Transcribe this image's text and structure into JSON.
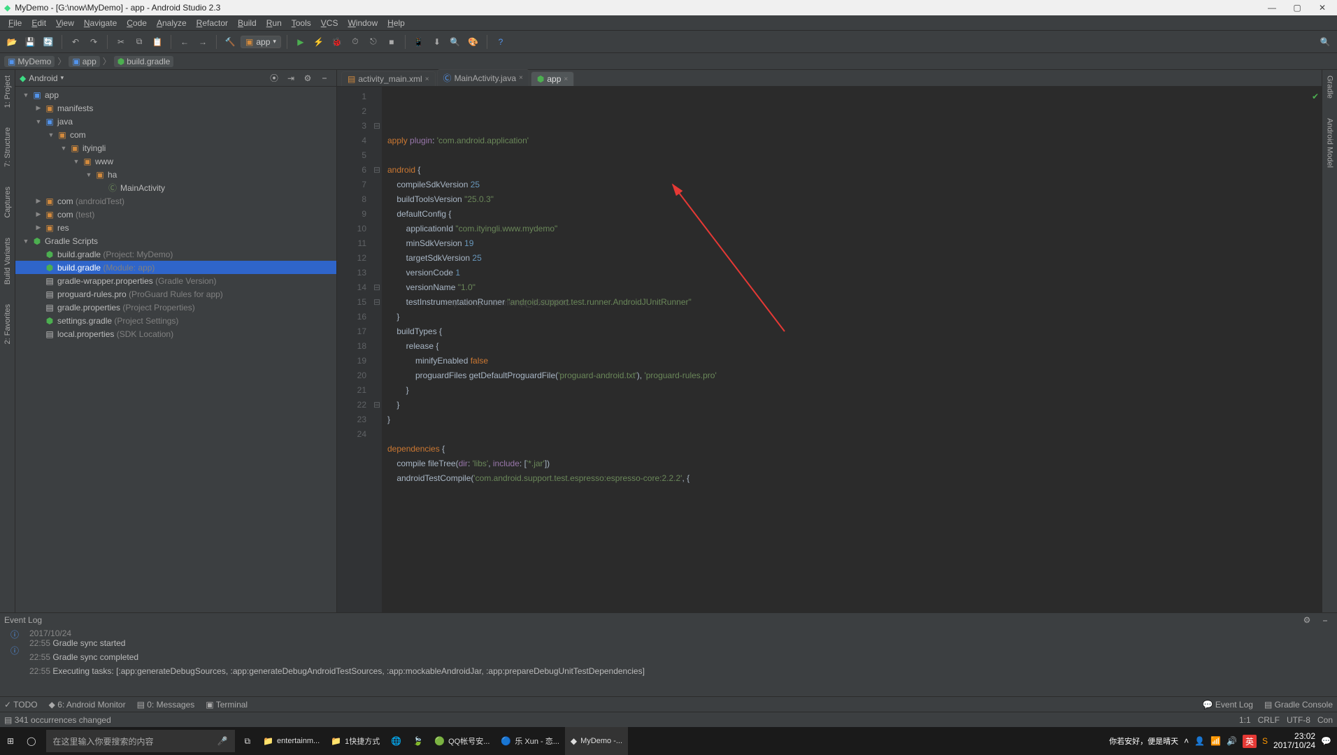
{
  "title": "MyDemo - [G:\\now\\MyDemo] - app - Android Studio 2.3",
  "menubar": [
    "File",
    "Edit",
    "View",
    "Navigate",
    "Code",
    "Analyze",
    "Refactor",
    "Build",
    "Run",
    "Tools",
    "VCS",
    "Window",
    "Help"
  ],
  "run_config": "app",
  "breadcrumbs": [
    {
      "icon": "folder",
      "label": "MyDemo"
    },
    {
      "icon": "folder",
      "label": "app"
    },
    {
      "icon": "gradle",
      "label": "build.gradle"
    }
  ],
  "left_strips": [
    "1: Project",
    "7: Structure",
    "Captures",
    "Build Variants",
    "2: Favorites"
  ],
  "right_strips": [
    "Gradle",
    "Android Model"
  ],
  "pane_header": "Android",
  "tree": [
    {
      "d": 0,
      "arrow": "▼",
      "icon": "folder",
      "cls": "folder-blue",
      "label": "app"
    },
    {
      "d": 1,
      "arrow": "▶",
      "icon": "folder",
      "cls": "folder-orange",
      "label": "manifests"
    },
    {
      "d": 1,
      "arrow": "▼",
      "icon": "folder",
      "cls": "folder-blue",
      "label": "java"
    },
    {
      "d": 2,
      "arrow": "▼",
      "icon": "pkg",
      "cls": "folder-orange",
      "label": "com"
    },
    {
      "d": 3,
      "arrow": "▼",
      "icon": "pkg",
      "cls": "folder-orange",
      "label": "ityingli"
    },
    {
      "d": 4,
      "arrow": "▼",
      "icon": "pkg",
      "cls": "folder-orange",
      "label": "www"
    },
    {
      "d": 5,
      "arrow": "▼",
      "icon": "pkg",
      "cls": "folder-orange",
      "label": "ha"
    },
    {
      "d": 6,
      "arrow": "",
      "icon": "class",
      "cls": "ic-green",
      "label": "MainActivity"
    },
    {
      "d": 1,
      "arrow": "▶",
      "icon": "pkg",
      "cls": "folder-orange",
      "label": "com",
      "dim": "(androidTest)"
    },
    {
      "d": 1,
      "arrow": "▶",
      "icon": "pkg",
      "cls": "folder-orange",
      "label": "com",
      "dim": "(test)"
    },
    {
      "d": 1,
      "arrow": "▶",
      "icon": "folder",
      "cls": "folder-orange",
      "label": "res"
    },
    {
      "d": 0,
      "arrow": "▼",
      "icon": "gradle",
      "cls": "gradle-green",
      "label": "Gradle Scripts"
    },
    {
      "d": 1,
      "arrow": "",
      "icon": "gradle",
      "cls": "gradle-green",
      "label": "build.gradle",
      "dim": "(Project: MyDemo)"
    },
    {
      "d": 1,
      "arrow": "",
      "icon": "gradle",
      "cls": "gradle-green",
      "label": "build.gradle",
      "dim": "(Module: app)",
      "selected": true
    },
    {
      "d": 1,
      "arrow": "",
      "icon": "file",
      "cls": "",
      "label": "gradle-wrapper.properties",
      "dim": "(Gradle Version)"
    },
    {
      "d": 1,
      "arrow": "",
      "icon": "file",
      "cls": "",
      "label": "proguard-rules.pro",
      "dim": "(ProGuard Rules for app)"
    },
    {
      "d": 1,
      "arrow": "",
      "icon": "file",
      "cls": "",
      "label": "gradle.properties",
      "dim": "(Project Properties)"
    },
    {
      "d": 1,
      "arrow": "",
      "icon": "gradle",
      "cls": "gradle-green",
      "label": "settings.gradle",
      "dim": "(Project Settings)"
    },
    {
      "d": 1,
      "arrow": "",
      "icon": "file",
      "cls": "",
      "label": "local.properties",
      "dim": "(SDK Location)"
    }
  ],
  "editor_tabs": [
    {
      "label": "activity_main.xml",
      "active": false,
      "icon": "xml"
    },
    {
      "label": "MainActivity.java",
      "active": false,
      "icon": "class"
    },
    {
      "label": "app",
      "active": true,
      "icon": "gradle"
    }
  ],
  "code_lines": [
    {
      "n": 1,
      "html": "<span class='kw'>apply</span> <span class='prop'>plugin</span>: <span class='str'>'com.android.application'</span>"
    },
    {
      "n": 2,
      "html": ""
    },
    {
      "n": 3,
      "html": "<span class='kw'>android</span> {"
    },
    {
      "n": 4,
      "html": "    compileSdkVersion <span class='num'>25</span>"
    },
    {
      "n": 5,
      "html": "    buildToolsVersion <span class='str'>\"25.0.3\"</span>"
    },
    {
      "n": 6,
      "html": "    defaultConfig {"
    },
    {
      "n": 7,
      "html": "        applicationId <span class='str'>\"com.ityingli.www.mydemo\"</span>"
    },
    {
      "n": 8,
      "html": "        minSdkVersion <span class='num'>19</span>"
    },
    {
      "n": 9,
      "html": "        targetSdkVersion <span class='num'>25</span>"
    },
    {
      "n": 10,
      "html": "        versionCode <span class='num'>1</span>"
    },
    {
      "n": 11,
      "html": "        versionName <span class='str'>\"1.0\"</span>"
    },
    {
      "n": 12,
      "html": "        testInstrumentationRunner <span class='str'>\"android.support.test.runner.AndroidJUnitRunner\"</span>"
    },
    {
      "n": 13,
      "html": "    }"
    },
    {
      "n": 14,
      "html": "    buildTypes {"
    },
    {
      "n": 15,
      "html": "        release {"
    },
    {
      "n": 16,
      "html": "            minifyEnabled <span class='kw'>false</span>"
    },
    {
      "n": 17,
      "html": "            proguardFiles getDefaultProguardFile(<span class='str'>'proguard-android.txt'</span>), <span class='str'>'proguard-rules.pro'</span>"
    },
    {
      "n": 18,
      "html": "        }"
    },
    {
      "n": 19,
      "html": "    }"
    },
    {
      "n": 20,
      "html": "}"
    },
    {
      "n": 21,
      "html": ""
    },
    {
      "n": 22,
      "html": "<span class='kw'>dependencies</span> {"
    },
    {
      "n": 23,
      "html": "    compile fileTree(<span class='prop'>dir</span>: <span class='str'>'libs'</span>, <span class='prop'>include</span>: [<span class='str'>'*.jar'</span>])"
    },
    {
      "n": 24,
      "html": "    androidTestCompile(<span class='str'>'com.android.support.test.espresso:espresso-core:2.2.2'</span>, {"
    }
  ],
  "watermark": "http://blog.csdn.net/qq_35270692",
  "event_log_title": "Event Log",
  "event_date": "2017/10/24",
  "events": [
    {
      "time": "22:55",
      "msg": "Gradle sync started"
    },
    {
      "time": "22:55",
      "msg": "Gradle sync completed"
    },
    {
      "time": "22:55",
      "msg": "Executing tasks: [:app:generateDebugSources, :app:generateDebugAndroidTestSources, :app:mockableAndroidJar, :app:prepareDebugUnitTestDependencies]"
    }
  ],
  "bottom_tools_left": [
    "TODO",
    "6: Android Monitor",
    "0: Messages",
    "Terminal"
  ],
  "bottom_tools_right": [
    "Event Log",
    "Gradle Console"
  ],
  "status_left": "341 occurrences changed",
  "status_right": {
    "pos": "1:1",
    "eol": "CRLF",
    "enc": "UTF-8",
    "ctx": "Con"
  },
  "taskbar": {
    "search_placeholder": "在这里输入你要搜索的内容",
    "items": [
      {
        "label": "entertainm..."
      },
      {
        "label": "1快捷方式"
      },
      {
        "label": ""
      },
      {
        "label": ""
      },
      {
        "label": "QQ帐号安..."
      },
      {
        "label": "乐 Xun - 恋..."
      },
      {
        "label": "MyDemo -...",
        "active": true
      }
    ],
    "weather": "你若安好，便是晴天",
    "time": "23:02",
    "date": "2017/10/24",
    "ime": "英"
  }
}
